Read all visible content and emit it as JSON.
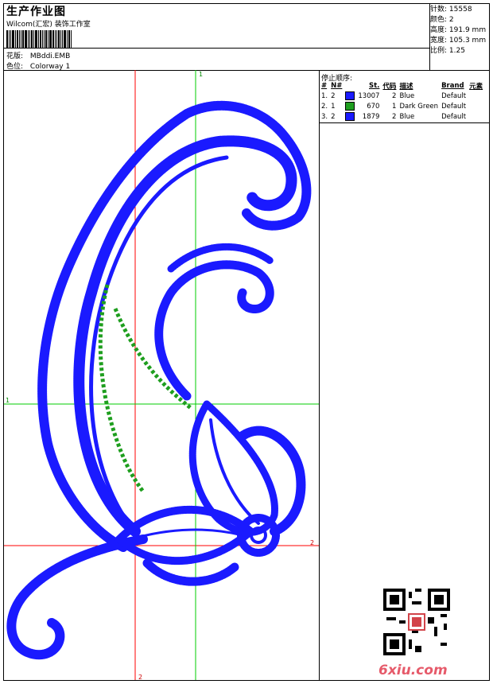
{
  "header": {
    "title": "生产作业图",
    "company": "Wilcom(汇宏) 装饰工作室",
    "design_label": "花版:",
    "design_value": "MBddi.EMB",
    "colorway_label": "色位:",
    "colorway_value": "Colorway 1"
  },
  "stats": [
    {
      "label": "针数:",
      "value": "15558"
    },
    {
      "label": "颜色:",
      "value": "2"
    },
    {
      "label": "高度:",
      "value": "191.9 mm"
    },
    {
      "label": "宽度:",
      "value": "105.3 mm"
    },
    {
      "label": "比例:",
      "value": "1.25"
    }
  ],
  "stop_sequence": {
    "title": "停止顺序:",
    "columns": [
      "#",
      "N#",
      "St.",
      "代码",
      "描述",
      "Brand",
      "元素"
    ],
    "rows": [
      {
        "num": "1.",
        "n": "2",
        "color": "#1a1aff",
        "st": "13007",
        "code": "2",
        "desc": "Blue",
        "brand": "Default"
      },
      {
        "num": "2.",
        "n": "1",
        "color": "#1e9e1e",
        "st": "670",
        "code": "1",
        "desc": "Dark Green",
        "brand": "Default"
      },
      {
        "num": "3.",
        "n": "2",
        "color": "#1a1aff",
        "st": "1879",
        "code": "2",
        "desc": "Blue",
        "brand": "Default"
      }
    ]
  },
  "guides": {
    "top": "1",
    "left": "1",
    "right": "2",
    "bottom": "2"
  },
  "watermark": "6xiu.com",
  "colors": {
    "blue": "#1a1aff",
    "green": "#1e9e1e",
    "red_guide": "#ff0000",
    "green_guide": "#00cc00"
  }
}
